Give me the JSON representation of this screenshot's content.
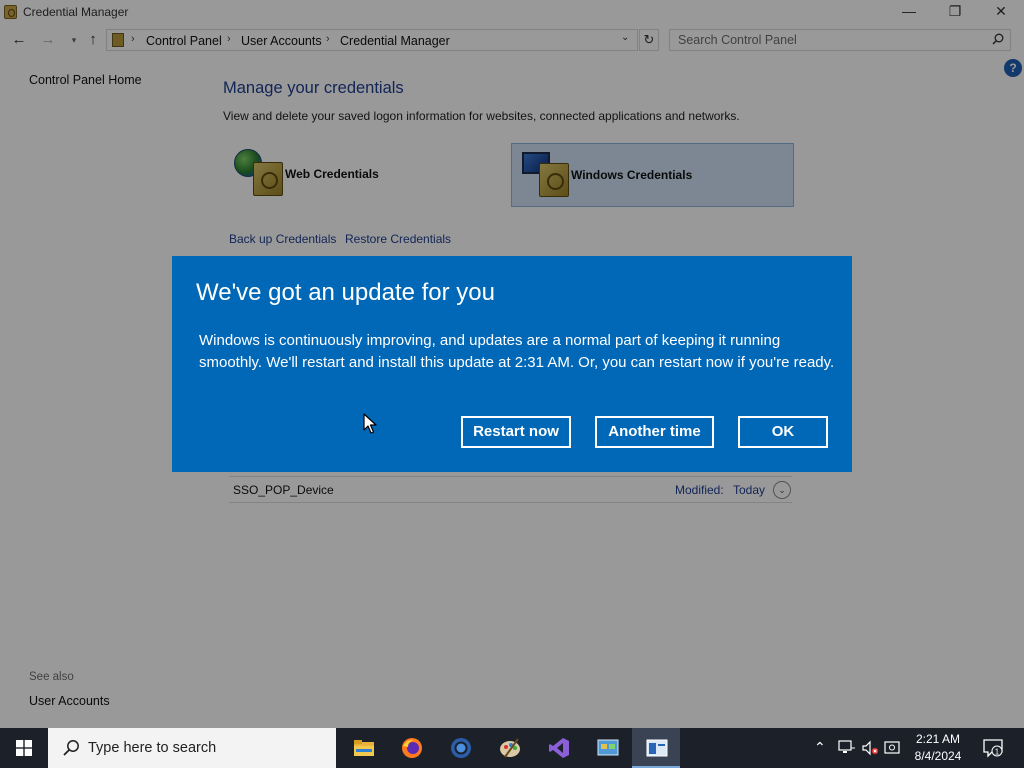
{
  "window": {
    "title": "Credential Manager",
    "minimize_glyph": "—",
    "maximize_glyph": "❐",
    "close_glyph": "✕"
  },
  "address_bar": {
    "breadcrumbs": [
      "Control Panel",
      "User Accounts",
      "Credential Manager"
    ],
    "search_placeholder": "Search Control Panel"
  },
  "sidebar": {
    "home_link": "Control Panel Home",
    "see_also_label": "See also",
    "see_also_links": [
      "User Accounts"
    ]
  },
  "main": {
    "title": "Manage your credentials",
    "description": "View and delete your saved logon information for websites, connected applications and networks.",
    "credential_types": [
      {
        "label": "Web Credentials",
        "icon": "globe-vault-icon",
        "selected": false
      },
      {
        "label": "Windows Credentials",
        "icon": "monitor-vault-icon",
        "selected": true
      }
    ],
    "links": {
      "backup": "Back up Credentials",
      "restore": "Restore Credentials"
    },
    "credential_rows": [
      {
        "name": "SSO_POP_Device",
        "modified_label": "Modified:",
        "modified_value": "Today"
      }
    ]
  },
  "update_dialog": {
    "title": "We've got an update for you",
    "body": "Windows is continuously improving, and updates are a normal part of keeping it running smoothly. We'll restart and install this update at 2:31 AM. Or, you can restart now if you're ready.",
    "buttons": {
      "restart": "Restart now",
      "another": "Another time",
      "ok": "OK"
    }
  },
  "taskbar": {
    "search_placeholder": "Type here to search",
    "apps": [
      "file-explorer-icon",
      "firefox-icon",
      "chrome-icon",
      "paint-icon",
      "visual-studio-icon",
      "control-panel-icon",
      "credential-manager-icon"
    ],
    "clock_time": "2:21 AM",
    "clock_date": "8/4/2024",
    "notification_count": "1"
  },
  "colors": {
    "dialog_bg": "#0168b8",
    "link": "#1e3f8f",
    "taskbar_bg": "#1c2029",
    "selected_tile": "#cfe2f5"
  }
}
